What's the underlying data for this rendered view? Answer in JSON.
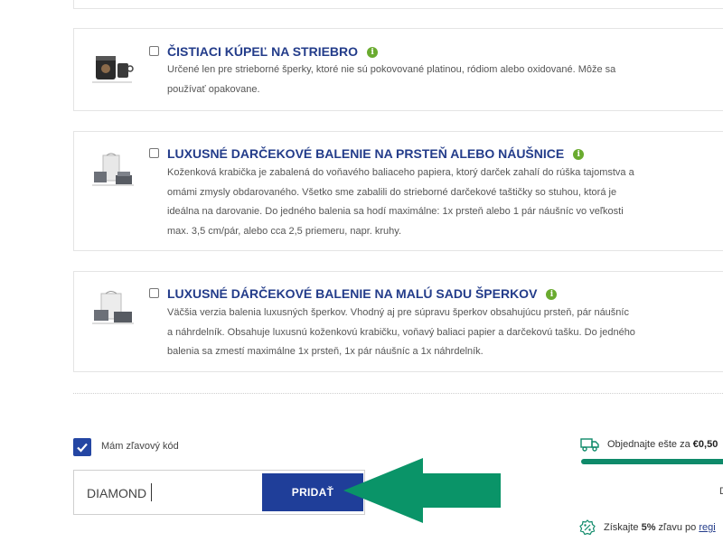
{
  "addons": [
    {
      "title": "ČISTIACI KÚPEĽ NA STRIEBRO",
      "desc": "Určené len pre strieborné šperky, ktoré nie sú pokovované platinou, ródiom alebo oxidované. Môže sa používať opakovane."
    },
    {
      "title": "LUXUSNÉ DARČEKOVÉ BALENIE NA PRSTEŇ ALEBO NÁUŠNICE",
      "desc": "Koženková krabička je zabalená do voňavého baliaceho papiera, ktorý darček zahalí do rúška tajomstva a omámi zmysly obdarovaného. Všetko sme zabalili do strieborné darčekové taštičky so stuhou, ktorá je ideálna na darovanie. Do jedného balenia sa hodí maximálne: 1x prsteň alebo 1 pár náušníc vo veľkosti max. 3,5 cm/pár, alebo cca 2,5 priemeru, napr. kruhy."
    },
    {
      "title": "LUXUSNÉ DÁRČEKOVÉ BALENIE NA MALÚ SADU ŠPERKOV",
      "desc": "Väčšia verzia balenia luxusných šperkov. Vhodný aj pre súpravu šperkov obsahujúcu prsteň, pár náušníc a náhrdelník. Obsahuje luxusnú koženkovú krabičku, voňavý baliaci papier a darčekovú tašku. Do jedného balenia sa zmestí maximálne 1x prsteň, 1x pár náušníc a 1x náhrdelník."
    }
  ],
  "info_glyph": "i",
  "discount": {
    "checkbox_label": "Mám zľavový kód",
    "checked": true,
    "code_value": "DIAMOND",
    "add_label": "PRIDAŤ"
  },
  "shipping": {
    "text_prefix": "Objednajte ešte za ",
    "amount": "€0,50",
    "progress": 1.0
  },
  "side_stub": "D",
  "promo": {
    "text_prefix": "Získajte ",
    "percent": "5%",
    "text_middle": " zľavu po ",
    "link": "regi"
  },
  "colors": {
    "accent_blue": "#1f3e99",
    "info_green": "#6aab2f",
    "arrow_green": "#0a9468",
    "progress_green": "#0f8a6a"
  },
  "icons": [
    "silver-cleaner-thumbnail",
    "gift-box-thumbnail",
    "gift-set-thumbnail",
    "truck-icon",
    "percent-badge-icon",
    "arrow-annotation"
  ]
}
